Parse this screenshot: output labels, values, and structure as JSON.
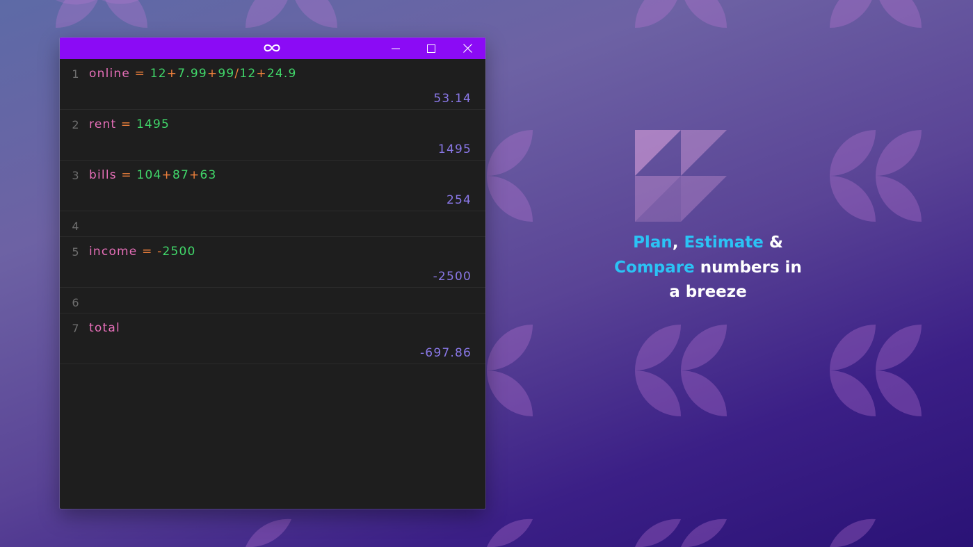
{
  "window": {
    "title_icon": "infinity-icon",
    "buttons": [
      "minimize-icon",
      "maximize-icon",
      "close-icon"
    ],
    "accent": "#8b0bf5",
    "background": "#1e1e1e"
  },
  "lines": [
    {
      "num": "1",
      "tokens": [
        {
          "t": "online",
          "k": "v"
        },
        {
          "t": " = ",
          "k": "o"
        },
        {
          "t": "12",
          "k": "n"
        },
        {
          "t": "+",
          "k": "o"
        },
        {
          "t": "7.99",
          "k": "n"
        },
        {
          "t": "+",
          "k": "o"
        },
        {
          "t": "99",
          "k": "n"
        },
        {
          "t": "/",
          "k": "o"
        },
        {
          "t": "12",
          "k": "n"
        },
        {
          "t": "+",
          "k": "o"
        },
        {
          "t": "24.9",
          "k": "n"
        }
      ],
      "result": "53.14"
    },
    {
      "num": "2",
      "tokens": [
        {
          "t": "rent",
          "k": "v"
        },
        {
          "t": " = ",
          "k": "o"
        },
        {
          "t": "1495",
          "k": "n"
        }
      ],
      "result": "1495"
    },
    {
      "num": "3",
      "tokens": [
        {
          "t": "bills",
          "k": "v"
        },
        {
          "t": " = ",
          "k": "o"
        },
        {
          "t": "104",
          "k": "n"
        },
        {
          "t": "+",
          "k": "o"
        },
        {
          "t": "87",
          "k": "n"
        },
        {
          "t": "+",
          "k": "o"
        },
        {
          "t": "63",
          "k": "n"
        }
      ],
      "result": "254"
    },
    {
      "num": "4",
      "tokens": [],
      "result": ""
    },
    {
      "num": "5",
      "tokens": [
        {
          "t": "income",
          "k": "v"
        },
        {
          "t": " = ",
          "k": "o"
        },
        {
          "t": "-",
          "k": "o"
        },
        {
          "t": "2500",
          "k": "n"
        }
      ],
      "result": "-2500"
    },
    {
      "num": "6",
      "tokens": [],
      "result": ""
    },
    {
      "num": "7",
      "tokens": [
        {
          "t": "total",
          "k": "v"
        }
      ],
      "result": "-697.86"
    }
  ],
  "tagline": {
    "w1": "Plan",
    "sep1": ", ",
    "w2": "Estimate",
    "sep2": " &",
    "w3": "Compare",
    "rest1": " numbers in",
    "rest2": "a breeze"
  },
  "colors": {
    "variable": "#e76fb9",
    "operator": "#f0813c",
    "number": "#41d86a",
    "result": "#8a78e8",
    "highlight": "#2bc3f5"
  }
}
